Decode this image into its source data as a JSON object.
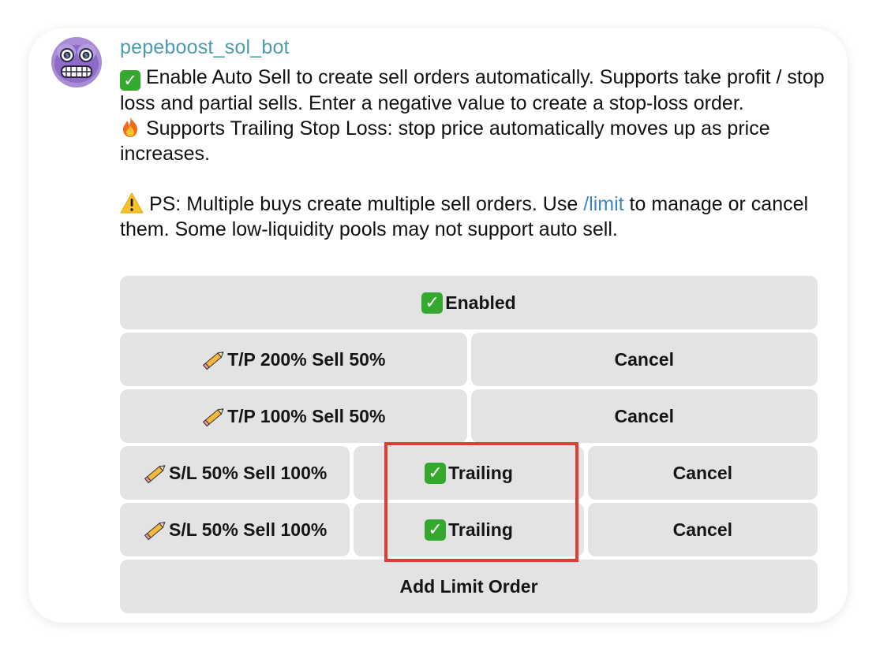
{
  "message": {
    "sender": "pepeboost_sol_bot",
    "line1_text": "Enable Auto Sell to create sell orders automatically. Supports take profit / stop loss and partial sells. Enter a negative value to create a stop-loss order.",
    "line2_text": "Supports Trailing Stop Loss: stop price automatically moves up as price increases.",
    "ps_prefix": "PS: Multiple buys create multiple sell orders. Use ",
    "ps_link": "/limit",
    "ps_suffix": " to manage or cancel them. Some low-liquidity pools may not support auto sell."
  },
  "keyboard": {
    "enabled_label": "Enabled",
    "tp_200_label": "T/P 200% Sell 50%",
    "tp_200_cancel": "Cancel",
    "tp_100_label": "T/P 100% Sell 50%",
    "tp_100_cancel": "Cancel",
    "sl_1_label": "S/L 50% Sell 100%",
    "sl_1_trailing": "Trailing",
    "sl_1_cancel": "Cancel",
    "sl_2_label": "S/L 50% Sell 100%",
    "sl_2_trailing": "Trailing",
    "sl_2_cancel": "Cancel",
    "add_limit_label": "Add Limit Order"
  },
  "icons": {
    "check": "✓",
    "avatar": "pepe-avatar-icon",
    "fire": "fire-icon",
    "warning": "warning-icon",
    "pencil": "pencil-icon"
  },
  "colors": {
    "sender": "#4a9bb1",
    "link": "#3d86c6",
    "button_bg": "#e3e3e3",
    "check_green": "#35a82e",
    "highlight_red": "#e13c2f"
  }
}
